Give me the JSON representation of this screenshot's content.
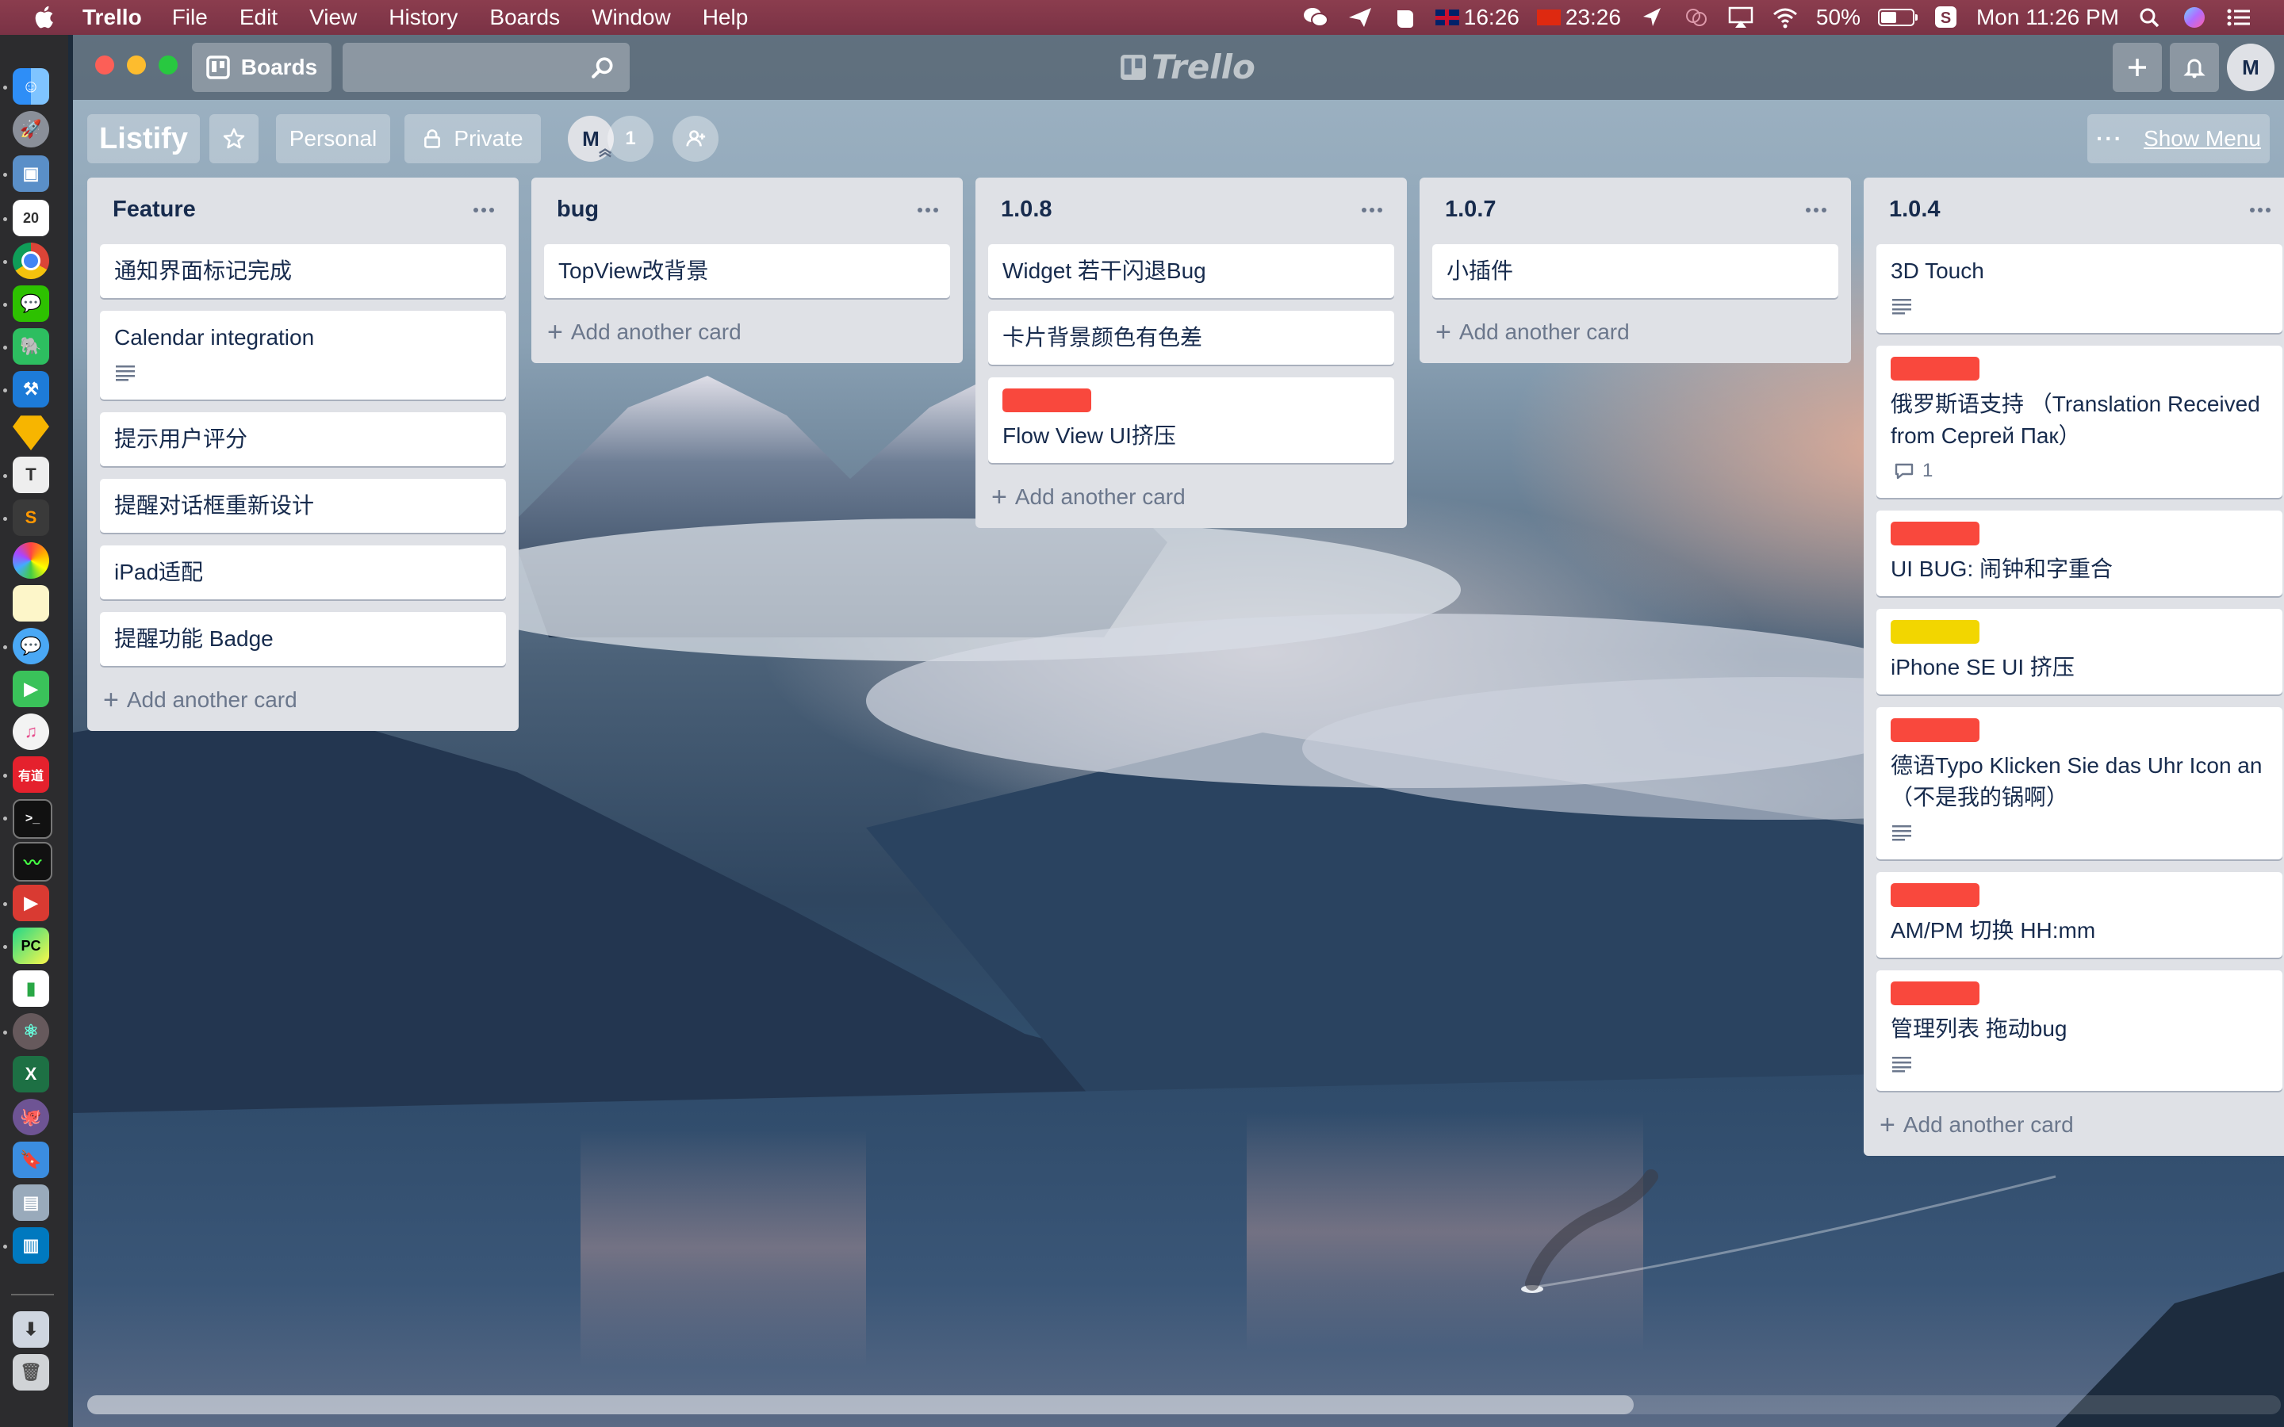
{
  "menubar": {
    "app_name": "Trello",
    "items": [
      "File",
      "Edit",
      "View",
      "History",
      "Boards",
      "Window",
      "Help"
    ],
    "clock_uk": "16:26",
    "clock_cn": "23:26",
    "battery_percent": "50%",
    "battery_level": 0.5,
    "datetime": "Mon 11:26 PM"
  },
  "titlebar": {
    "boards_label": "Boards",
    "search_placeholder": "",
    "logo_text": "Trello",
    "avatar_initial": "M"
  },
  "board": {
    "title": "Listify",
    "team_label": "Personal",
    "visibility_label": "Private",
    "member_initial": "M",
    "member_count": "1",
    "show_menu_label": "Show Menu"
  },
  "add_card_label": "Add another card",
  "lists": [
    {
      "title": "Feature",
      "cards": [
        {
          "text": "通知界面标记完成"
        },
        {
          "text": "Calendar integration",
          "has_description": true
        },
        {
          "text": "提示用户评分"
        },
        {
          "text": "提醒对话框重新设计"
        },
        {
          "text": "iPad适配"
        },
        {
          "text": "提醒功能 Badge"
        }
      ]
    },
    {
      "title": "bug",
      "cards": [
        {
          "text": "TopView改背景"
        }
      ]
    },
    {
      "title": "1.0.8",
      "cards": [
        {
          "text": "Widget 若干闪退Bug"
        },
        {
          "text": "卡片背景颜色有色差"
        },
        {
          "text": "Flow View UI挤压",
          "label": "red"
        }
      ]
    },
    {
      "title": "1.0.7",
      "cards": [
        {
          "text": "小插件"
        }
      ]
    },
    {
      "title": "1.0.4",
      "cards": [
        {
          "text": "3D Touch",
          "has_description": true
        },
        {
          "text": "俄罗斯语支持 （Translation Received from Сергей Пак）",
          "label": "red",
          "comments": "1"
        },
        {
          "text": "UI BUG: 闹钟和字重合",
          "label": "red"
        },
        {
          "text": "iPhone SE UI 挤压",
          "label": "yellow"
        },
        {
          "text": "德语Typo Klicken Sie das Uhr Icon an （不是我的锅啊）",
          "label": "red",
          "has_description": true
        },
        {
          "text": "AM/PM 切换 HH:mm",
          "label": "red"
        },
        {
          "text": "管理列表 拖动bug",
          "label": "red",
          "has_description": true
        }
      ]
    }
  ],
  "colors": {
    "label_red": "#f9483d",
    "label_yellow": "#f2d600",
    "list_bg": "#dfe1e6",
    "menubar_bg": "#7a3245"
  }
}
